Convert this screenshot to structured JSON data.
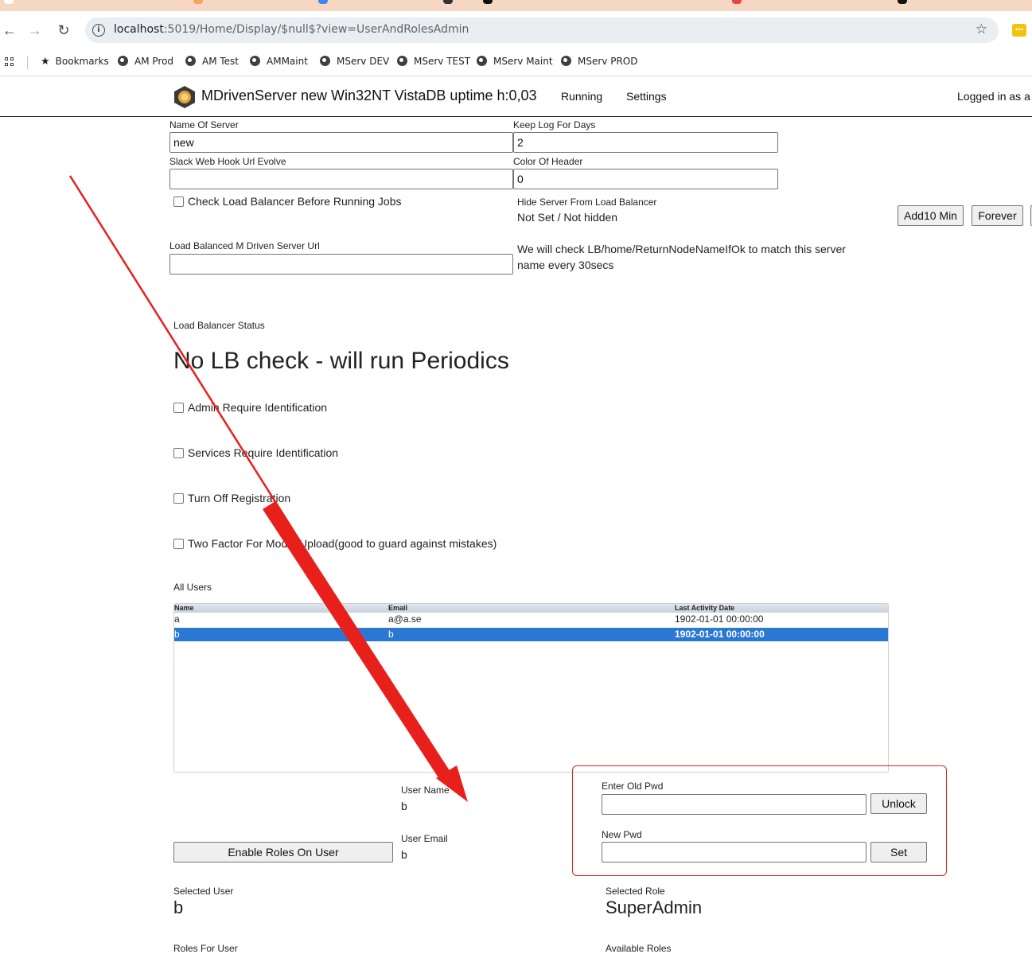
{
  "browser": {
    "url_host": "localhost",
    "url_rest": ":5019/Home/Display/$null$?view=UserAndRolesAdmin",
    "bookmarks": [
      {
        "label": "Bookmarks"
      },
      {
        "label": "AM Prod"
      },
      {
        "label": "AM Test"
      },
      {
        "label": "AMMaint"
      },
      {
        "label": "MServ DEV"
      },
      {
        "label": "MServ TEST"
      },
      {
        "label": "MServ Maint"
      },
      {
        "label": "MServ PROD"
      }
    ],
    "ext_glyph": "•••"
  },
  "header": {
    "brand": "MDrivenServer new Win32NT VistaDB uptime h:0,03",
    "nav": [
      "Running",
      "Settings"
    ],
    "logged_in": "Logged in as a"
  },
  "settings": {
    "name_of_server_label": "Name Of Server",
    "name_of_server_value": "new",
    "keep_log_label": "Keep Log For Days",
    "keep_log_value": "2",
    "slack_label": "Slack Web Hook Url Evolve",
    "slack_value": "",
    "color_header_label": "Color Of Header",
    "color_header_value": "0",
    "check_lb_label": "Check Load Balancer Before Running Jobs",
    "hide_server_label": "Hide Server From Load Balancer",
    "hide_server_value": "Not Set / Not hidden",
    "add10_label": "Add10 Min",
    "forever_label": "Forever",
    "lb_url_label": "Load Balanced M Driven Server Url",
    "lb_url_value": "",
    "lb_note_line1": "We will check LB/home/ReturnNodeNameIfOk to match this server",
    "lb_note_line2": "name every 30secs",
    "lb_status_label": "Load Balancer Status",
    "lb_status_value": "No LB check - will run Periodics",
    "admin_req_label": "Admin Require Identification",
    "services_req_label": "Services Require Identification",
    "turn_off_reg_label": "Turn Off Registration",
    "two_factor_label": "Two Factor For Model Upload(good to guard against mistakes)"
  },
  "users": {
    "section_label": "All Users",
    "columns": [
      "Name",
      "Email",
      "Last Activity Date"
    ],
    "rows": [
      {
        "name": "a",
        "email": "a@a.se",
        "last": "1902-01-01 00:00:00"
      },
      {
        "name": "b",
        "email": "b",
        "last": "1902-01-01 00:00:00"
      }
    ]
  },
  "details": {
    "user_name_label": "User Name",
    "user_name_value": "b",
    "user_email_label": "User Email",
    "user_email_value": "b",
    "enable_roles_label": "Enable Roles On User",
    "old_pwd_label": "Enter Old Pwd",
    "unlock_label": "Unlock",
    "new_pwd_label": "New Pwd",
    "set_label": "Set",
    "selected_user_label": "Selected User",
    "selected_user_value": "b",
    "selected_role_label": "Selected Role",
    "selected_role_value": "SuperAdmin",
    "roles_for_user_label": "Roles For User",
    "available_roles_label": "Available Roles"
  },
  "colors": {
    "selection": "#2a78d4",
    "annotation_red": "#e02020",
    "tabstrip": "#f6d7c3"
  }
}
